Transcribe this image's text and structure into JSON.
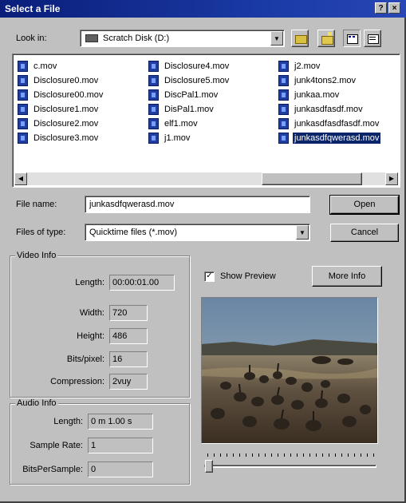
{
  "window": {
    "title": "Select a File",
    "help_btn": "?",
    "close_btn": "×"
  },
  "lookin": {
    "label": "Look in:",
    "value": "Scratch Disk (D:)",
    "toolbar_icons": [
      "up-folder-icon",
      "new-folder-icon",
      "list-view-icon",
      "details-view-icon"
    ]
  },
  "files": {
    "col1": [
      "c.mov",
      "Disclosure0.mov",
      "Disclosure00.mov",
      "Disclosure1.mov",
      "Disclosure2.mov",
      "Disclosure3.mov"
    ],
    "col2": [
      "Disclosure4.mov",
      "Disclosure5.mov",
      "DiscPal1.mov",
      "DisPal1.mov",
      "elf1.mov",
      "j1.mov"
    ],
    "col3": [
      "j2.mov",
      "junk4tons2.mov",
      "junkaa.mov",
      "junkasdfasdf.mov",
      "junkasdfasdfasdf.mov",
      "junkasdfqwerasd.mov"
    ],
    "selected": "junkasdfqwerasd.mov"
  },
  "filename": {
    "label": "File name:",
    "value": "junkasdfqwerasd.mov"
  },
  "filetype": {
    "label": "Files of type:",
    "value": "Quicktime files (*.mov)"
  },
  "buttons": {
    "open": "Open",
    "cancel": "Cancel",
    "more_info": "More Info"
  },
  "preview": {
    "checkbox_label": "Show Preview",
    "checked": true
  },
  "video_info": {
    "title": "Video Info",
    "length_label": "Length:",
    "length": "00:00:01.00",
    "width_label": "Width:",
    "width": "720",
    "height_label": "Height:",
    "height": "486",
    "bpp_label": "Bits/pixel:",
    "bpp": "16",
    "compression_label": "Compression:",
    "compression": "2vuy"
  },
  "audio_info": {
    "title": "Audio Info",
    "length_label": "Length:",
    "length": "0 m 1.00 s",
    "rate_label": "Sample Rate:",
    "rate": "1",
    "bps_label": "BitsPerSample:",
    "bps": "0"
  },
  "colors": {
    "selection": "#0a246a",
    "titlebar": "#0a1e7a",
    "face": "#c0c0c0"
  }
}
